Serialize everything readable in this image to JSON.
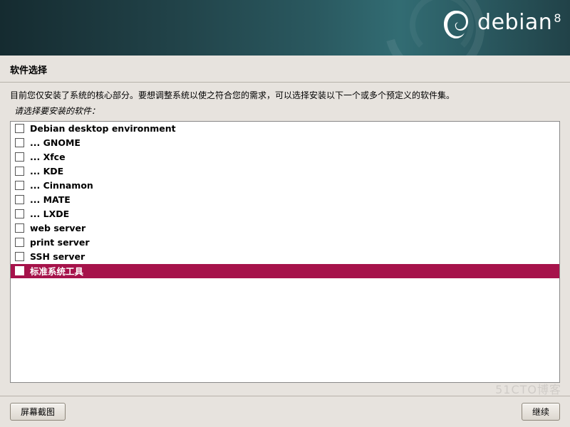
{
  "brand": {
    "name": "debian",
    "version": "8"
  },
  "title": "软件选择",
  "description": "目前您仅安装了系统的核心部分。要想调整系统以使之符合您的需求，可以选择安装以下一个或多个预定义的软件集。",
  "prompt": "请选择要安装的软件：",
  "software": {
    "items": [
      {
        "label": "Debian desktop environment",
        "checked": false,
        "selected": false
      },
      {
        "label": "... GNOME",
        "checked": false,
        "selected": false
      },
      {
        "label": "... Xfce",
        "checked": false,
        "selected": false
      },
      {
        "label": "... KDE",
        "checked": false,
        "selected": false
      },
      {
        "label": "... Cinnamon",
        "checked": false,
        "selected": false
      },
      {
        "label": "... MATE",
        "checked": false,
        "selected": false
      },
      {
        "label": "... LXDE",
        "checked": false,
        "selected": false
      },
      {
        "label": "web server",
        "checked": false,
        "selected": false
      },
      {
        "label": "print server",
        "checked": false,
        "selected": false
      },
      {
        "label": "SSH server",
        "checked": false,
        "selected": false
      },
      {
        "label": "标准系统工具",
        "checked": false,
        "selected": true
      }
    ]
  },
  "buttons": {
    "screenshot": "屏幕截图",
    "continue": "继续"
  },
  "watermark": "51CTO博客"
}
